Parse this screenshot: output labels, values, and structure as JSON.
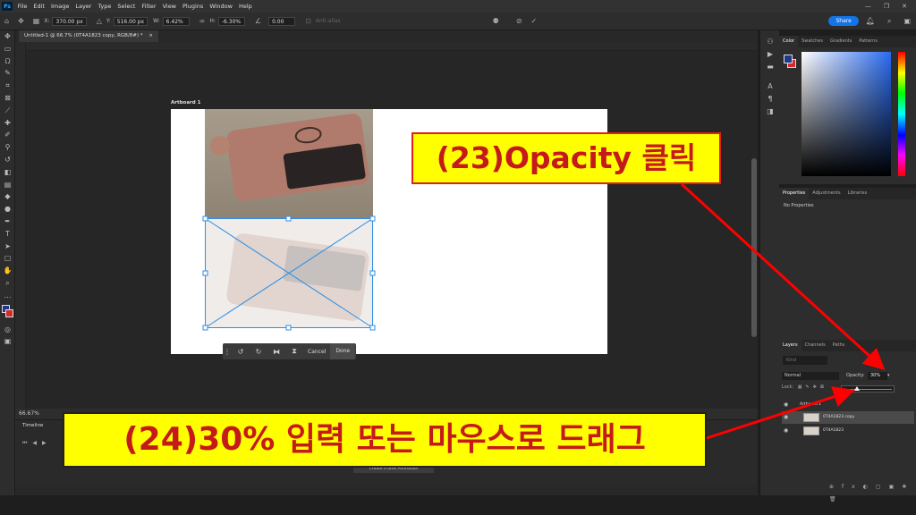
{
  "menubar": {
    "logo": "Ps",
    "items": [
      "File",
      "Edit",
      "Image",
      "Layer",
      "Type",
      "Select",
      "Filter",
      "View",
      "Plugins",
      "Window",
      "Help"
    ]
  },
  "optbar": {
    "x_label": "X:",
    "x_value": "370.00 px",
    "y_label": "Y:",
    "y_value": "516.00 px",
    "w_label": "W:",
    "w_value": "6.42%",
    "h_label": "H:",
    "h_value": "-6.30%",
    "angle_value": "0.00",
    "antialias": "Anti-alias",
    "share": "Share"
  },
  "tab": {
    "title": "Untitled-1 @ 66.7% (0T4A1823 copy, RGB/8#) *",
    "close": "×"
  },
  "canvas": {
    "artboard_label": "Artboard 1"
  },
  "ctxbar": {
    "cancel": "Cancel",
    "done": "Done"
  },
  "status": {
    "zoom": "66.67%"
  },
  "timeline": {
    "title": "Timeline",
    "create_button": "Create Frame Animation"
  },
  "panels": {
    "color_tabs": [
      "Color",
      "Swatches",
      "Gradients",
      "Patterns"
    ],
    "props_tabs": [
      "Properties",
      "Adjustments",
      "Libraries"
    ],
    "props_empty": "No Properties",
    "layers_tabs": [
      "Layers",
      "Channels",
      "Paths"
    ],
    "layers_search": "Kind",
    "blend_mode": "Normal",
    "opacity_label": "Opacity:",
    "opacity_value": "30%",
    "lock_label": "Lock:",
    "artboard_layer": "Artboard 1",
    "layers": [
      {
        "name": "0T4A1823 copy"
      },
      {
        "name": "0T4A1823"
      }
    ]
  },
  "annotations": {
    "step23": "(23)Opacity 클릭",
    "step24": "(24)30% 입력 또는 마우스로 드래그"
  },
  "colors": {
    "callout_bg": "#ffff00",
    "callout_text": "#c51a1a",
    "arrow": "#ff0000",
    "share_button": "#1473e6"
  }
}
